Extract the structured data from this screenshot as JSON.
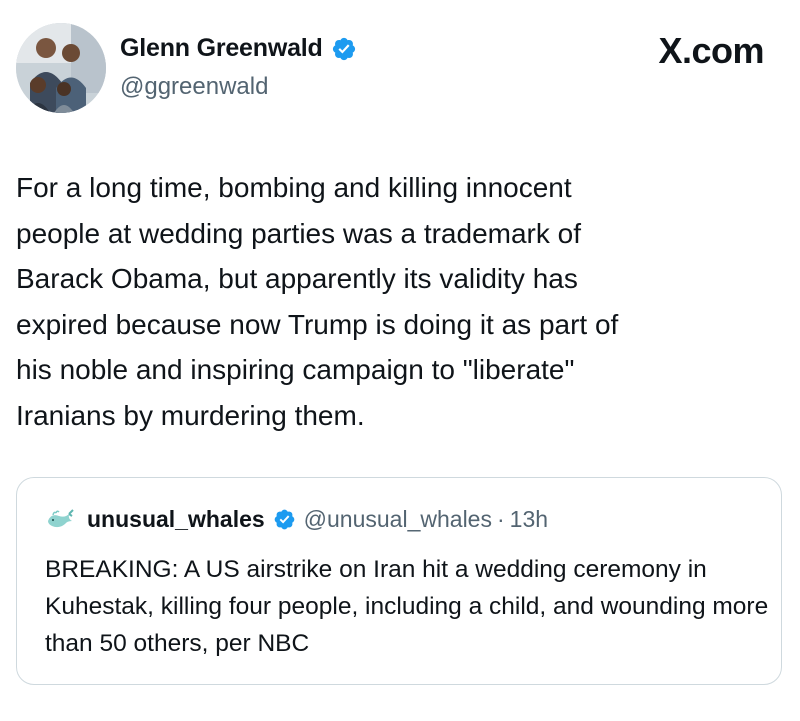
{
  "author": {
    "display_name": "Glenn Greenwald",
    "handle": "@ggreenwald",
    "verified_icon": "verified-badge-icon",
    "badge_color": "#1d9bf0"
  },
  "brand": {
    "label": "X.com"
  },
  "tweet": {
    "text": "For a long time, bombing and killing innocent\npeople at wedding parties was a trademark of\nBarack Obama, but apparently its validity has\nexpired because now Trump is doing it as part of\nhis noble and inspiring campaign to \"liberate\"\nIranians by murdering them."
  },
  "quoted_tweet": {
    "display_name": "unusual_whales",
    "handle": "@unusual_whales",
    "separator": "·",
    "time": "13h",
    "avatar_icon": "whale-icon",
    "text": "BREAKING: A US airstrike on Iran hit a wedding ceremony in Kuhestak, killing four people, including a child, and wounding more than 50 others, per NBC"
  },
  "colors": {
    "text": "#0f1419",
    "secondary_text": "#536471",
    "border": "#cfd9de",
    "verified_blue": "#1d9bf0"
  }
}
